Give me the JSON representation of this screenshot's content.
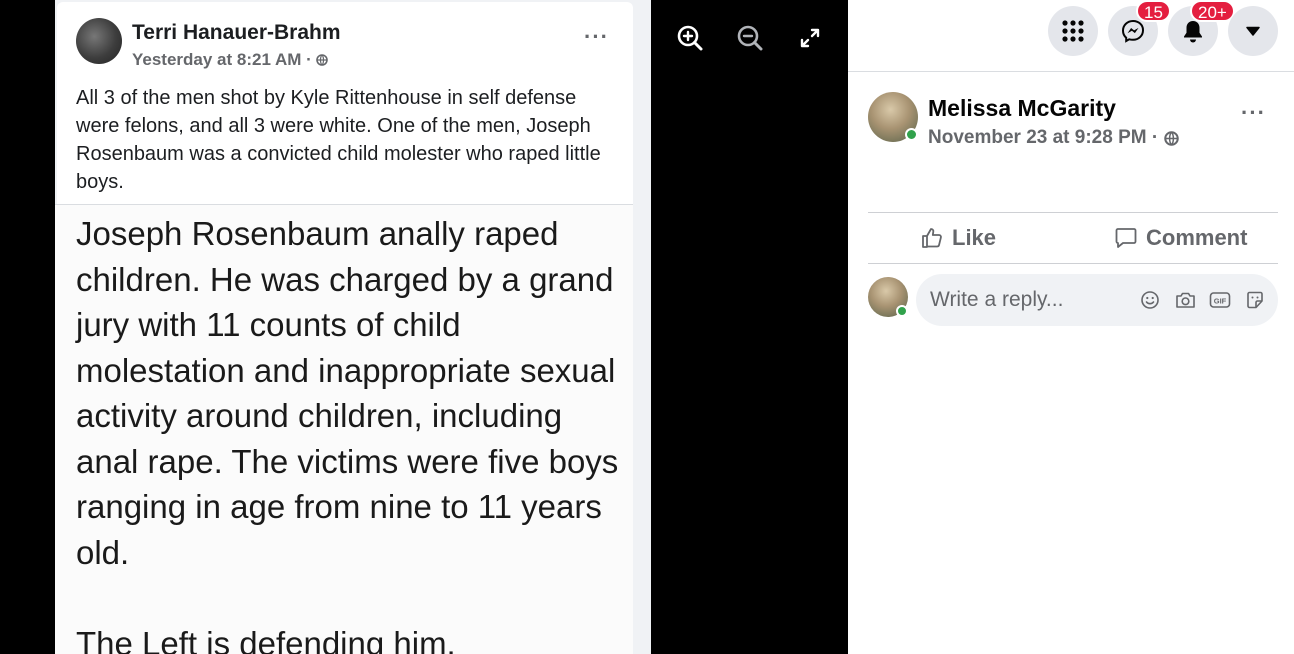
{
  "screenshot_post": {
    "author": "Terri Hanauer-Brahm",
    "time": "Yesterday at 8:21 AM ·",
    "text": "All 3 of the men shot by Kyle Rittenhouse in self defense were felons, and all 3 were white.  One of the men, Joseph Rosenbaum was a convicted child molester who raped little boys.",
    "tweet_text": "Joseph Rosenbaum anally raped children. He was charged by a grand jury with 11 counts of child molestation and inappropriate sexual activity around children, including anal rape. The victims were five boys ranging in age from nine to 11 years old.\n\nThe Left is defending him.",
    "more": "···"
  },
  "viewer_controls": {
    "zoom_in_icon": "zoom-in-icon",
    "zoom_out_icon": "zoom-out-icon",
    "fullscreen_icon": "fullscreen-icon"
  },
  "topbar": {
    "menu_icon": "grid-menu-icon",
    "messenger_badge": "15",
    "notifications_badge": "20+",
    "account_icon": "caret-down-icon"
  },
  "post": {
    "author": "Melissa McGarity",
    "time": "November 23 at 9:28 PM ·",
    "more": "···"
  },
  "actions": {
    "like": "Like",
    "comment": "Comment"
  },
  "reply": {
    "placeholder": "Write a reply..."
  },
  "colors": {
    "badge": "#e41e3f",
    "online": "#31a24c",
    "secondary_text": "#65676b"
  }
}
